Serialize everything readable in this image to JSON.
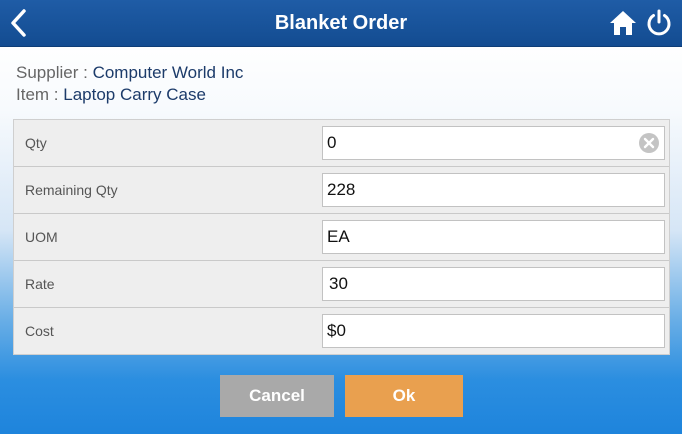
{
  "header": {
    "title": "Blanket Order",
    "color": "#134c91"
  },
  "info": {
    "supplier_label": "Supplier :",
    "supplier_value": "Computer World Inc",
    "item_label": "Item :",
    "item_value": "Laptop Carry Case"
  },
  "form": {
    "rows": [
      {
        "label": "Qty",
        "value": "0",
        "clearable": true
      },
      {
        "label": "Remaining Qty",
        "value": "228"
      },
      {
        "label": "UOM",
        "value": "EA"
      },
      {
        "label": "Rate",
        "value": "30"
      },
      {
        "label": "Cost",
        "value": "$0"
      }
    ]
  },
  "buttons": {
    "cancel": "Cancel",
    "ok": "Ok",
    "cancel_color": "#a9a9a9",
    "ok_color": "#e9a04f"
  },
  "icons": {
    "back": "chevron-left-icon",
    "home": "home-icon",
    "power": "power-icon",
    "clear": "clear-circle-icon"
  }
}
